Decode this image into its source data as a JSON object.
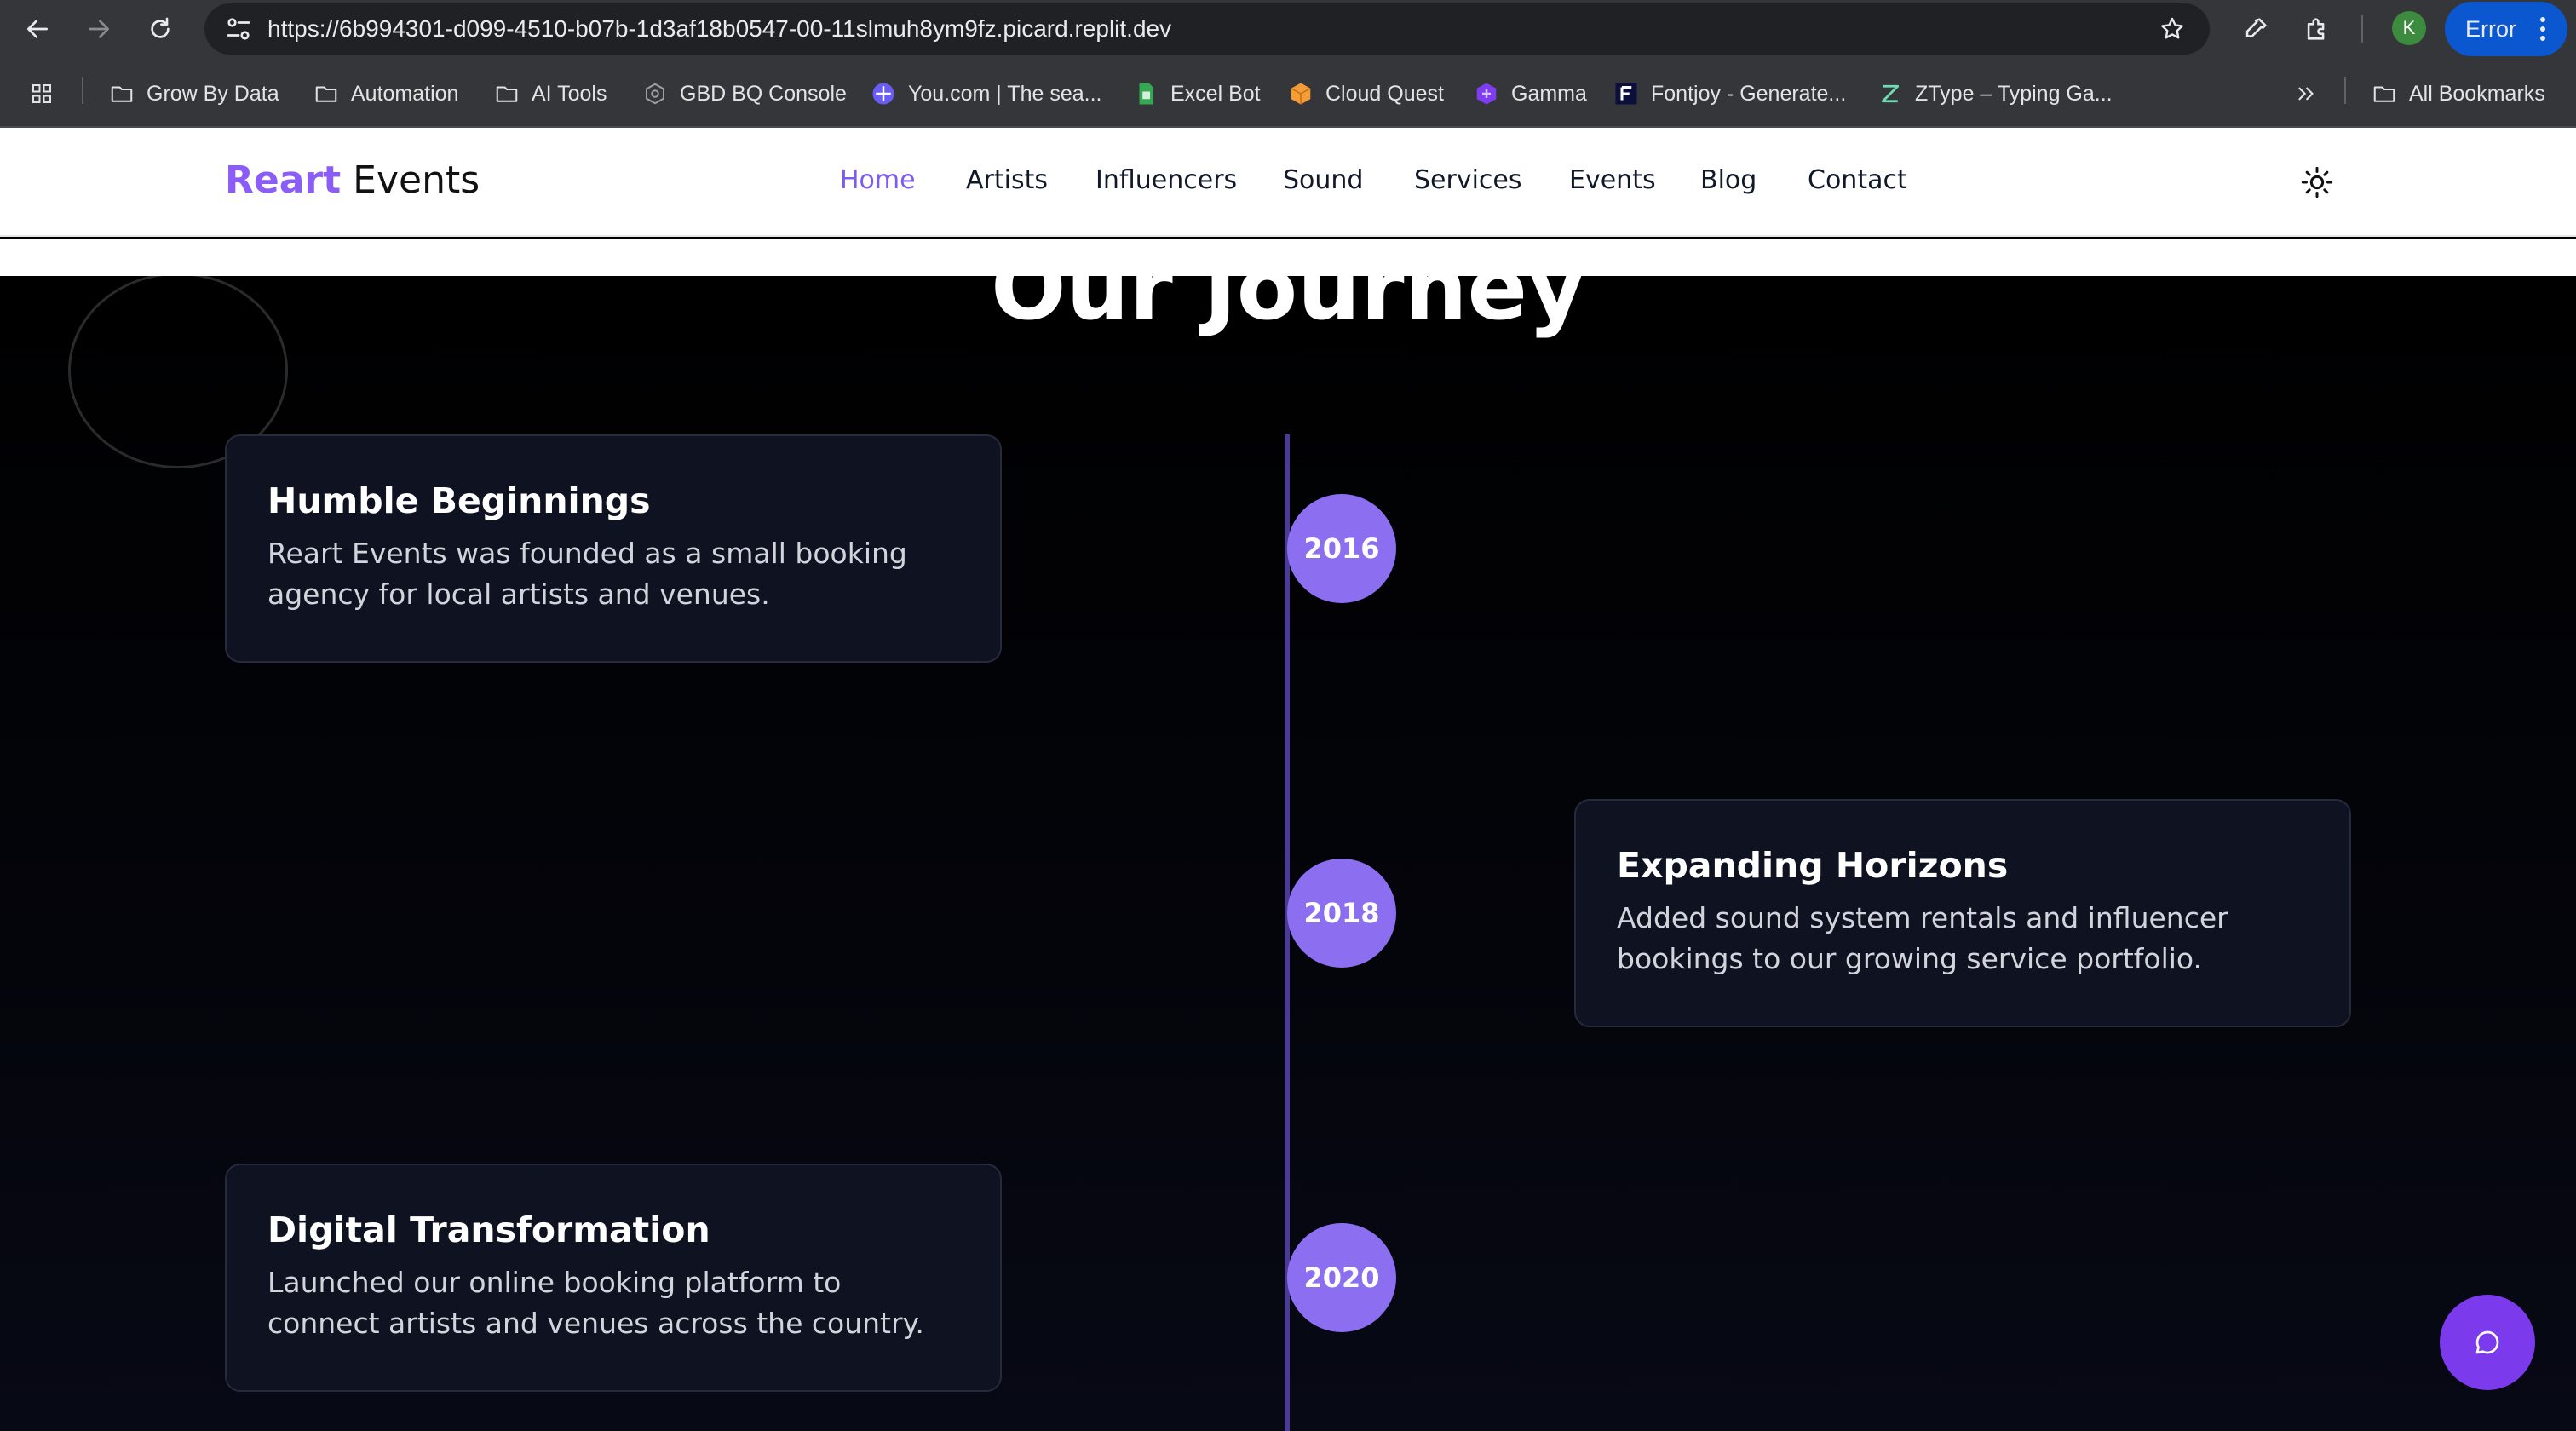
{
  "browser": {
    "url": "https://6b994301-d099-4510-b07b-1d3af18b0547-00-11slmuh8ym9fz.picard.replit.dev",
    "profile_initial": "K",
    "status_pill": "Error",
    "bookmarks": [
      {
        "label": "Grow By Data",
        "icon": "folder-icon"
      },
      {
        "label": "Automation",
        "icon": "folder-icon"
      },
      {
        "label": "AI Tools",
        "icon": "folder-icon"
      },
      {
        "label": "GBD BQ Console",
        "icon": "bigquery-icon"
      },
      {
        "label": "You.com | The sea...",
        "icon": "youcom-icon"
      },
      {
        "label": "Excel Bot",
        "icon": "sheet-icon"
      },
      {
        "label": "Cloud Quest",
        "icon": "cube-icon"
      },
      {
        "label": "Gamma",
        "icon": "gamma-icon"
      },
      {
        "label": "Fontjoy - Generate...",
        "icon": "fontjoy-icon"
      },
      {
        "label": "ZType – Typing Ga...",
        "icon": "ztype-icon"
      }
    ],
    "all_bookmarks": "All Bookmarks"
  },
  "site": {
    "logo_brand": "Reart",
    "logo_rest": "Events",
    "nav": [
      "Home",
      "Artists",
      "Influencers",
      "Sound",
      "Services",
      "Events",
      "Blog",
      "Contact"
    ],
    "active_nav": "Home",
    "accent_color": "#8b5cf6"
  },
  "journey": {
    "title": "Our Journey",
    "milestones": [
      {
        "year": "2016",
        "title": "Humble Beginnings",
        "text": "Reart Events was founded as a small booking agency for local artists and venues."
      },
      {
        "year": "2018",
        "title": "Expanding Horizons",
        "text": "Added sound system rentals and influencer bookings to our growing service portfolio."
      },
      {
        "year": "2020",
        "title": "Digital Transformation",
        "text": "Launched our online booking platform to connect artists and venues across the country."
      }
    ]
  }
}
